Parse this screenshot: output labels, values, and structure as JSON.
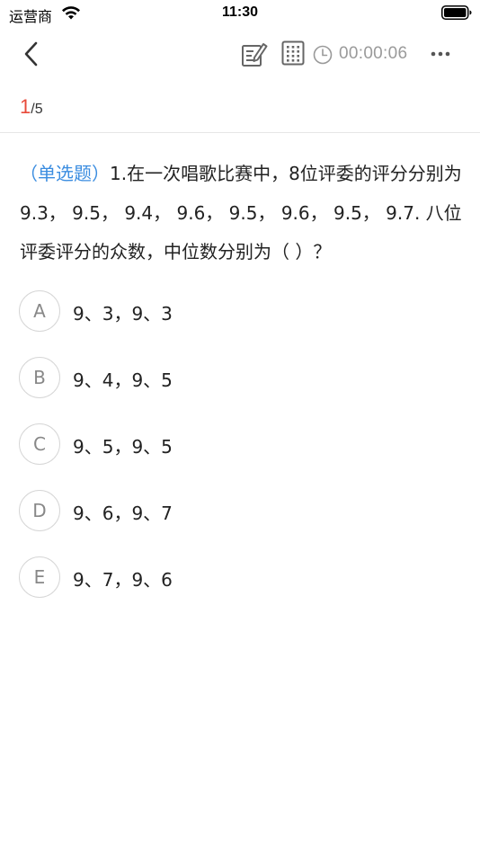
{
  "status_bar": {
    "carrier": "运营商",
    "time": "11:30"
  },
  "nav": {
    "timer": "00:00:06"
  },
  "progress": {
    "current": "1",
    "total": "/5"
  },
  "question": {
    "type_label": "（单选题）",
    "text": "1.在一次唱歌比赛中，8位评委的评分分别为9.3，  9.5，  9.4，  9.6，  9.5，  9.6，  9.5，  9.7. 八位评委评分的众数，中位数分别为（ ）？"
  },
  "options": [
    {
      "letter": "A",
      "text": "9、3，9、3"
    },
    {
      "letter": "B",
      "text": "9、4，9、5"
    },
    {
      "letter": "C",
      "text": "9、5，9、5"
    },
    {
      "letter": "D",
      "text": "9、6，9、7"
    },
    {
      "letter": "E",
      "text": "9、7，9、6"
    }
  ],
  "icons": {
    "status": [
      "wifi-icon",
      "battery-icon"
    ],
    "nav": [
      "back-icon",
      "note-icon",
      "answer-card-icon",
      "clock-icon",
      "more-icon"
    ]
  },
  "colors": {
    "accent_blue": "#3b8de0",
    "progress_red": "#e84a3a",
    "timer_gray": "#9a9a9a"
  }
}
